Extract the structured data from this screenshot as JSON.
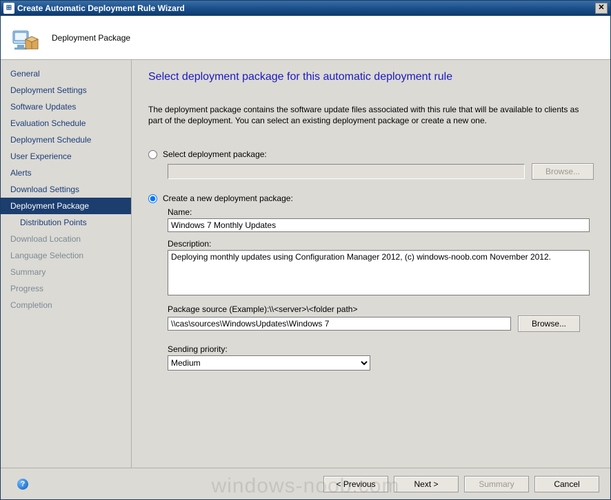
{
  "window": {
    "title": "Create Automatic Deployment Rule Wizard"
  },
  "banner": {
    "label": "Deployment Package"
  },
  "sidebar": {
    "steps": [
      {
        "label": "General",
        "state": "normal"
      },
      {
        "label": "Deployment Settings",
        "state": "normal"
      },
      {
        "label": "Software Updates",
        "state": "normal"
      },
      {
        "label": "Evaluation Schedule",
        "state": "normal"
      },
      {
        "label": "Deployment Schedule",
        "state": "normal"
      },
      {
        "label": "User Experience",
        "state": "normal"
      },
      {
        "label": "Alerts",
        "state": "normal"
      },
      {
        "label": "Download Settings",
        "state": "normal"
      },
      {
        "label": "Deployment Package",
        "state": "active"
      },
      {
        "label": "Distribution Points",
        "state": "normal",
        "sub": true
      },
      {
        "label": "Download Location",
        "state": "disabled"
      },
      {
        "label": "Language Selection",
        "state": "disabled"
      },
      {
        "label": "Summary",
        "state": "disabled"
      },
      {
        "label": "Progress",
        "state": "disabled"
      },
      {
        "label": "Completion",
        "state": "disabled"
      }
    ]
  },
  "page": {
    "title": "Select deployment package for this automatic deployment rule",
    "intro": "The deployment package contains the software update files associated with this rule that will be available to clients as part of the deployment. You can select an existing deployment package or create a new one.",
    "radio_select_label": "Select deployment package:",
    "radio_create_label": "Create a new deployment package:",
    "selected_radio": "create",
    "browse_label": "Browse...",
    "name_label": "Name:",
    "name_value": "Windows 7 Monthly Updates",
    "description_label": "Description:",
    "description_value": "Deploying monthly updates using Configuration Manager 2012, (c) windows-noob.com November 2012.",
    "source_label": "Package source (Example):\\\\<server>\\<folder path>",
    "source_value": "\\\\cas\\sources\\WindowsUpdates\\Windows 7",
    "priority_label": "Sending priority:",
    "priority_value": "Medium"
  },
  "footer": {
    "previous": "< Previous",
    "next": "Next >",
    "summary": "Summary",
    "cancel": "Cancel"
  },
  "watermark": "windows-noob.com"
}
